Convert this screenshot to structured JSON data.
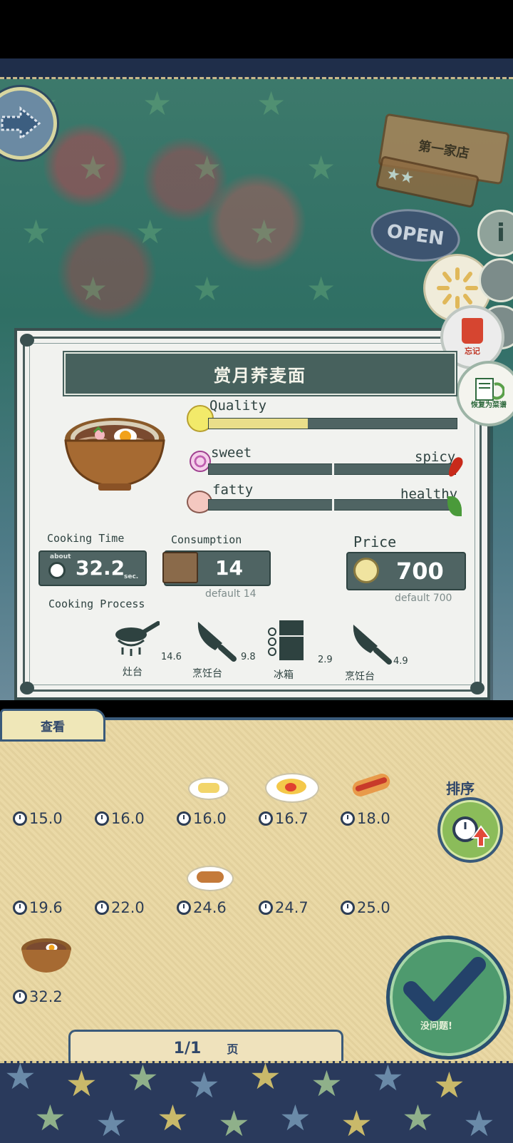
{
  "header": {
    "shop_sign": "第一家店",
    "open_sign": "OPEN",
    "info_icon": "i"
  },
  "side_buttons": {
    "forget_label": "忘记",
    "restore_label": "恢复为菜谱"
  },
  "dish": {
    "name": "赏月荞麦面",
    "stats": {
      "quality_label": "Quality",
      "quality_value": 0.4,
      "sweet_label": "sweet",
      "spicy_label": "spicy",
      "sweet_spicy_value": 0.5,
      "fatty_label": "fatty",
      "healthy_label": "healthy",
      "fatty_healthy_value": 0.5
    },
    "cooking_time": {
      "label": "Cooking Time",
      "about": "about",
      "value": "32.2",
      "unit": "sec."
    },
    "consumption": {
      "label": "Consumption",
      "value": "14",
      "default": "default 14"
    },
    "price": {
      "label": "Price",
      "value": "700",
      "default": "default 700"
    },
    "process_label": "Cooking Process",
    "process": [
      {
        "label": "灶台",
        "value": "14.6",
        "icon": "pan-icon"
      },
      {
        "label": "烹饪台",
        "value": "9.8",
        "icon": "knife-icon"
      },
      {
        "label": "冰箱",
        "value": "2.9",
        "icon": "fridge-icon"
      },
      {
        "label": "烹饪台",
        "value": "4.9",
        "icon": "knife-icon"
      }
    ]
  },
  "menu_list": {
    "tab_label": "查看",
    "sort_label": "排序",
    "rows": [
      [
        "15.0",
        "16.0",
        "16.0",
        "16.7",
        "18.0"
      ],
      [
        "19.6",
        "22.0",
        "24.6",
        "24.7",
        "25.0"
      ],
      [
        "32.2"
      ]
    ],
    "confirm_label": "没问题!",
    "pager": {
      "current": "1/1",
      "suffix": "页"
    }
  },
  "colors": {
    "panel_dark": "#47615d",
    "bar_fill": "#e9de8a",
    "bottom_bg": "#ead9a6",
    "accent_blue": "#3a5a7a"
  }
}
